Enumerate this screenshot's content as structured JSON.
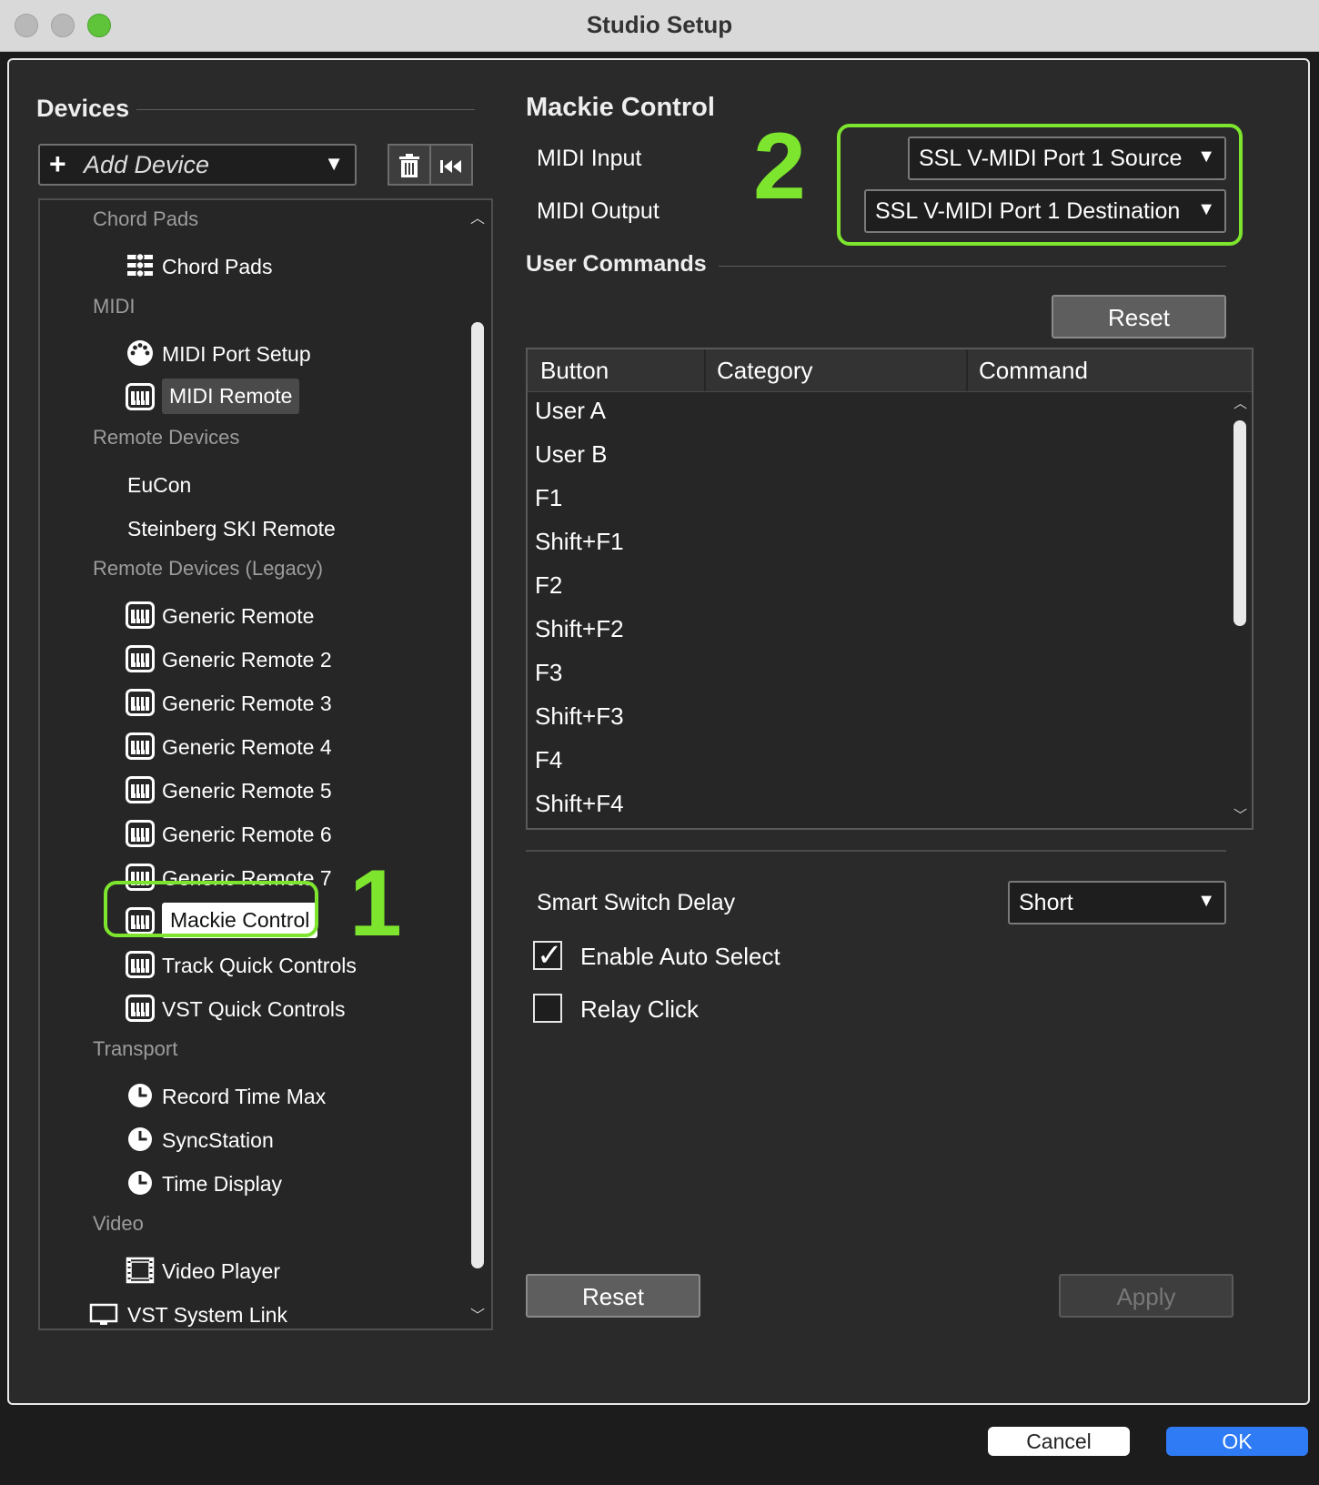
{
  "window": {
    "title": "Studio Setup"
  },
  "devices": {
    "heading": "Devices",
    "add_device": "Add Device",
    "tree": [
      {
        "type": "cat",
        "label": "Chord Pads"
      },
      {
        "type": "item",
        "label": "Chord Pads",
        "icon": "chord-pads-icon"
      },
      {
        "type": "cat",
        "label": "MIDI"
      },
      {
        "type": "item",
        "label": "MIDI Port Setup",
        "icon": "midi-port-icon"
      },
      {
        "type": "item",
        "label": "MIDI Remote",
        "icon": "remote-keys-icon",
        "state": "hl"
      },
      {
        "type": "cat",
        "label": "Remote Devices"
      },
      {
        "type": "item",
        "label": "EuCon",
        "icon": ""
      },
      {
        "type": "item",
        "label": "Steinberg SKI Remote",
        "icon": ""
      },
      {
        "type": "cat",
        "label": "Remote Devices (Legacy)"
      },
      {
        "type": "item",
        "label": "Generic Remote",
        "icon": "remote-keys-icon"
      },
      {
        "type": "item",
        "label": "Generic Remote 2",
        "icon": "remote-keys-icon"
      },
      {
        "type": "item",
        "label": "Generic Remote 3",
        "icon": "remote-keys-icon"
      },
      {
        "type": "item",
        "label": "Generic Remote 4",
        "icon": "remote-keys-icon"
      },
      {
        "type": "item",
        "label": "Generic Remote 5",
        "icon": "remote-keys-icon"
      },
      {
        "type": "item",
        "label": "Generic Remote 6",
        "icon": "remote-keys-icon"
      },
      {
        "type": "item",
        "label": "Generic Remote 7",
        "icon": "remote-keys-icon"
      },
      {
        "type": "item",
        "label": "Mackie Control",
        "icon": "remote-keys-icon",
        "state": "sel"
      },
      {
        "type": "item",
        "label": "Track Quick Controls",
        "icon": "remote-keys-icon"
      },
      {
        "type": "item",
        "label": "VST Quick Controls",
        "icon": "remote-keys-icon"
      },
      {
        "type": "cat",
        "label": "Transport"
      },
      {
        "type": "item",
        "label": "Record Time Max",
        "icon": "clock-icon"
      },
      {
        "type": "item",
        "label": "SyncStation",
        "icon": "clock-icon"
      },
      {
        "type": "item",
        "label": "Time Display",
        "icon": "clock-icon"
      },
      {
        "type": "cat",
        "label": "Video"
      },
      {
        "type": "item",
        "label": "Video Player",
        "icon": "film-icon"
      },
      {
        "type": "root",
        "label": "VST System Link",
        "icon": "monitor-icon"
      }
    ]
  },
  "annotations": {
    "one": "1",
    "two": "2",
    "color": "#7ee52e"
  },
  "mackie": {
    "heading": "Mackie Control",
    "midi_input_label": "MIDI Input",
    "midi_output_label": "MIDI Output",
    "midi_input_value": "SSL V-MIDI Port 1 Source",
    "midi_output_value": "SSL V-MIDI Port 1 Destination",
    "user_commands_heading": "User Commands",
    "reset_label": "Reset",
    "columns": [
      "Button",
      "Category",
      "Command"
    ],
    "rows": [
      "User A",
      "User B",
      "F1",
      "Shift+F1",
      "F2",
      "Shift+F2",
      "F3",
      "Shift+F3",
      "F4",
      "Shift+F4"
    ],
    "smart_switch_label": "Smart Switch Delay",
    "smart_switch_value": "Short",
    "enable_auto_select": {
      "label": "Enable Auto Select",
      "checked": true
    },
    "relay_click": {
      "label": "Relay Click",
      "checked": false
    }
  },
  "footer": {
    "reset": "Reset",
    "apply": "Apply"
  },
  "dialog": {
    "cancel": "Cancel",
    "ok": "OK"
  }
}
